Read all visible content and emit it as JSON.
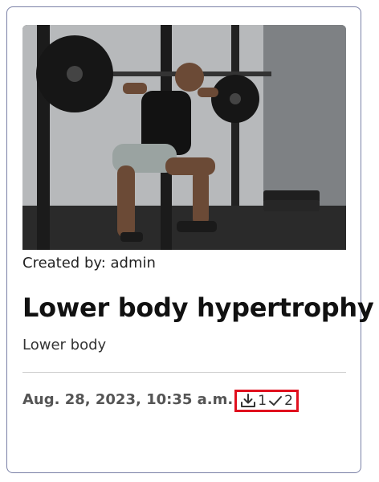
{
  "card": {
    "image_alt": "Man performing barbell squat in gym",
    "created_by": "Created by: admin",
    "title": "Lower body hypertrophy",
    "subtitle": "Lower body",
    "date": "Aug. 28, 2023, 10:35 a.m.",
    "downloads": "1",
    "completions": "2"
  },
  "colors": {
    "card_border": "#7a80a6",
    "highlight_border": "#e0101e",
    "text": "#111111",
    "muted": "#555555"
  }
}
